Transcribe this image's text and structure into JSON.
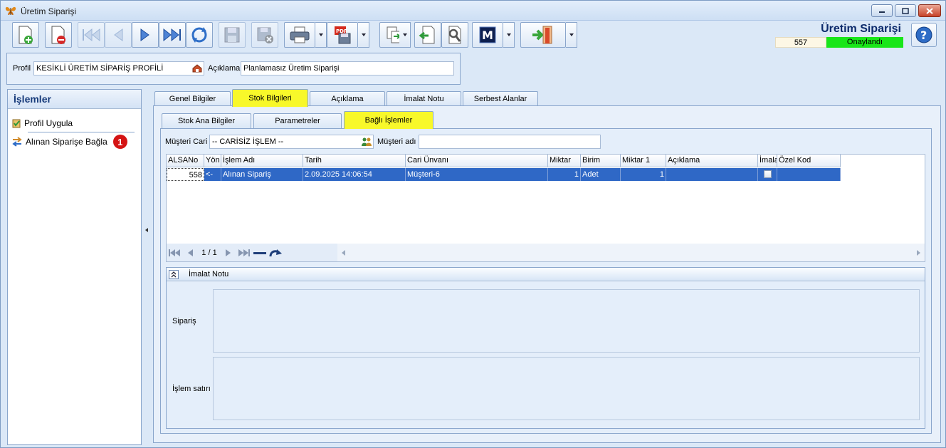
{
  "window": {
    "title": "Üretim Siparişi"
  },
  "header": {
    "doc_title": "Üretim Siparişi",
    "doc_no": "557",
    "status": "Onaylandı",
    "status_color": "#19e619"
  },
  "toolbar": {
    "buttons": [
      "new-document-icon",
      "delete-document-icon",
      "first-record-icon",
      "previous-record-icon",
      "next-record-icon",
      "last-record-icon",
      "refresh-icon",
      "save-icon",
      "save-close-icon",
      "print-icon",
      "pdf-icon",
      "export-icon",
      "import-icon",
      "settings-icon",
      "m-logo-icon",
      "exit-door-icon"
    ]
  },
  "profile": {
    "profile_label": "Profil",
    "profile_value": "KESİKLİ ÜRETİM SİPARİŞ PROFİLİ",
    "desc_label": "Açıklama",
    "desc_value": "Planlamasız Üretim Siparişi"
  },
  "sidebar": {
    "title": "İşlemler",
    "items": [
      {
        "label": "Profil Uygula"
      },
      {
        "label": "Alınan Siparişe Bağla",
        "badge": "1"
      }
    ]
  },
  "tabs": [
    "Genel Bilgiler",
    "Stok Bilgileri",
    "Açıklama",
    "İmalat Notu",
    "Serbest Alanlar"
  ],
  "subtabs": [
    "Stok Ana Bilgiler",
    "Parametreler",
    "Bağlı İşlemler"
  ],
  "filter": {
    "cari_label": "Müşteri Cari",
    "cari_value": "-- CARİSİZ İŞLEM --",
    "name_label": "Müşteri adı",
    "name_value": ""
  },
  "grid": {
    "headers": [
      "ALSANo",
      "Yön",
      "İşlem Adı",
      "Tarih",
      "Cari Ünvanı",
      "Miktar",
      "Birim",
      "Miktar 1",
      "Açıklama",
      "İmalat",
      "Özel Kod"
    ],
    "row": {
      "alsano": "558",
      "yon": "<-",
      "islem_adi": "Alınan Sipariş",
      "tarih": "2.09.2025 14:06:54",
      "cari_unvani": "Müşteri-6",
      "miktar": "1",
      "birim": "Adet",
      "miktar1": "1",
      "aciklama": "",
      "imalat": false,
      "ozel_kod": ""
    },
    "pager": "1 / 1"
  },
  "note_group": {
    "title": "İmalat Notu",
    "siparis_label": "Sipariş",
    "islem_label": "İşlem satırı"
  }
}
